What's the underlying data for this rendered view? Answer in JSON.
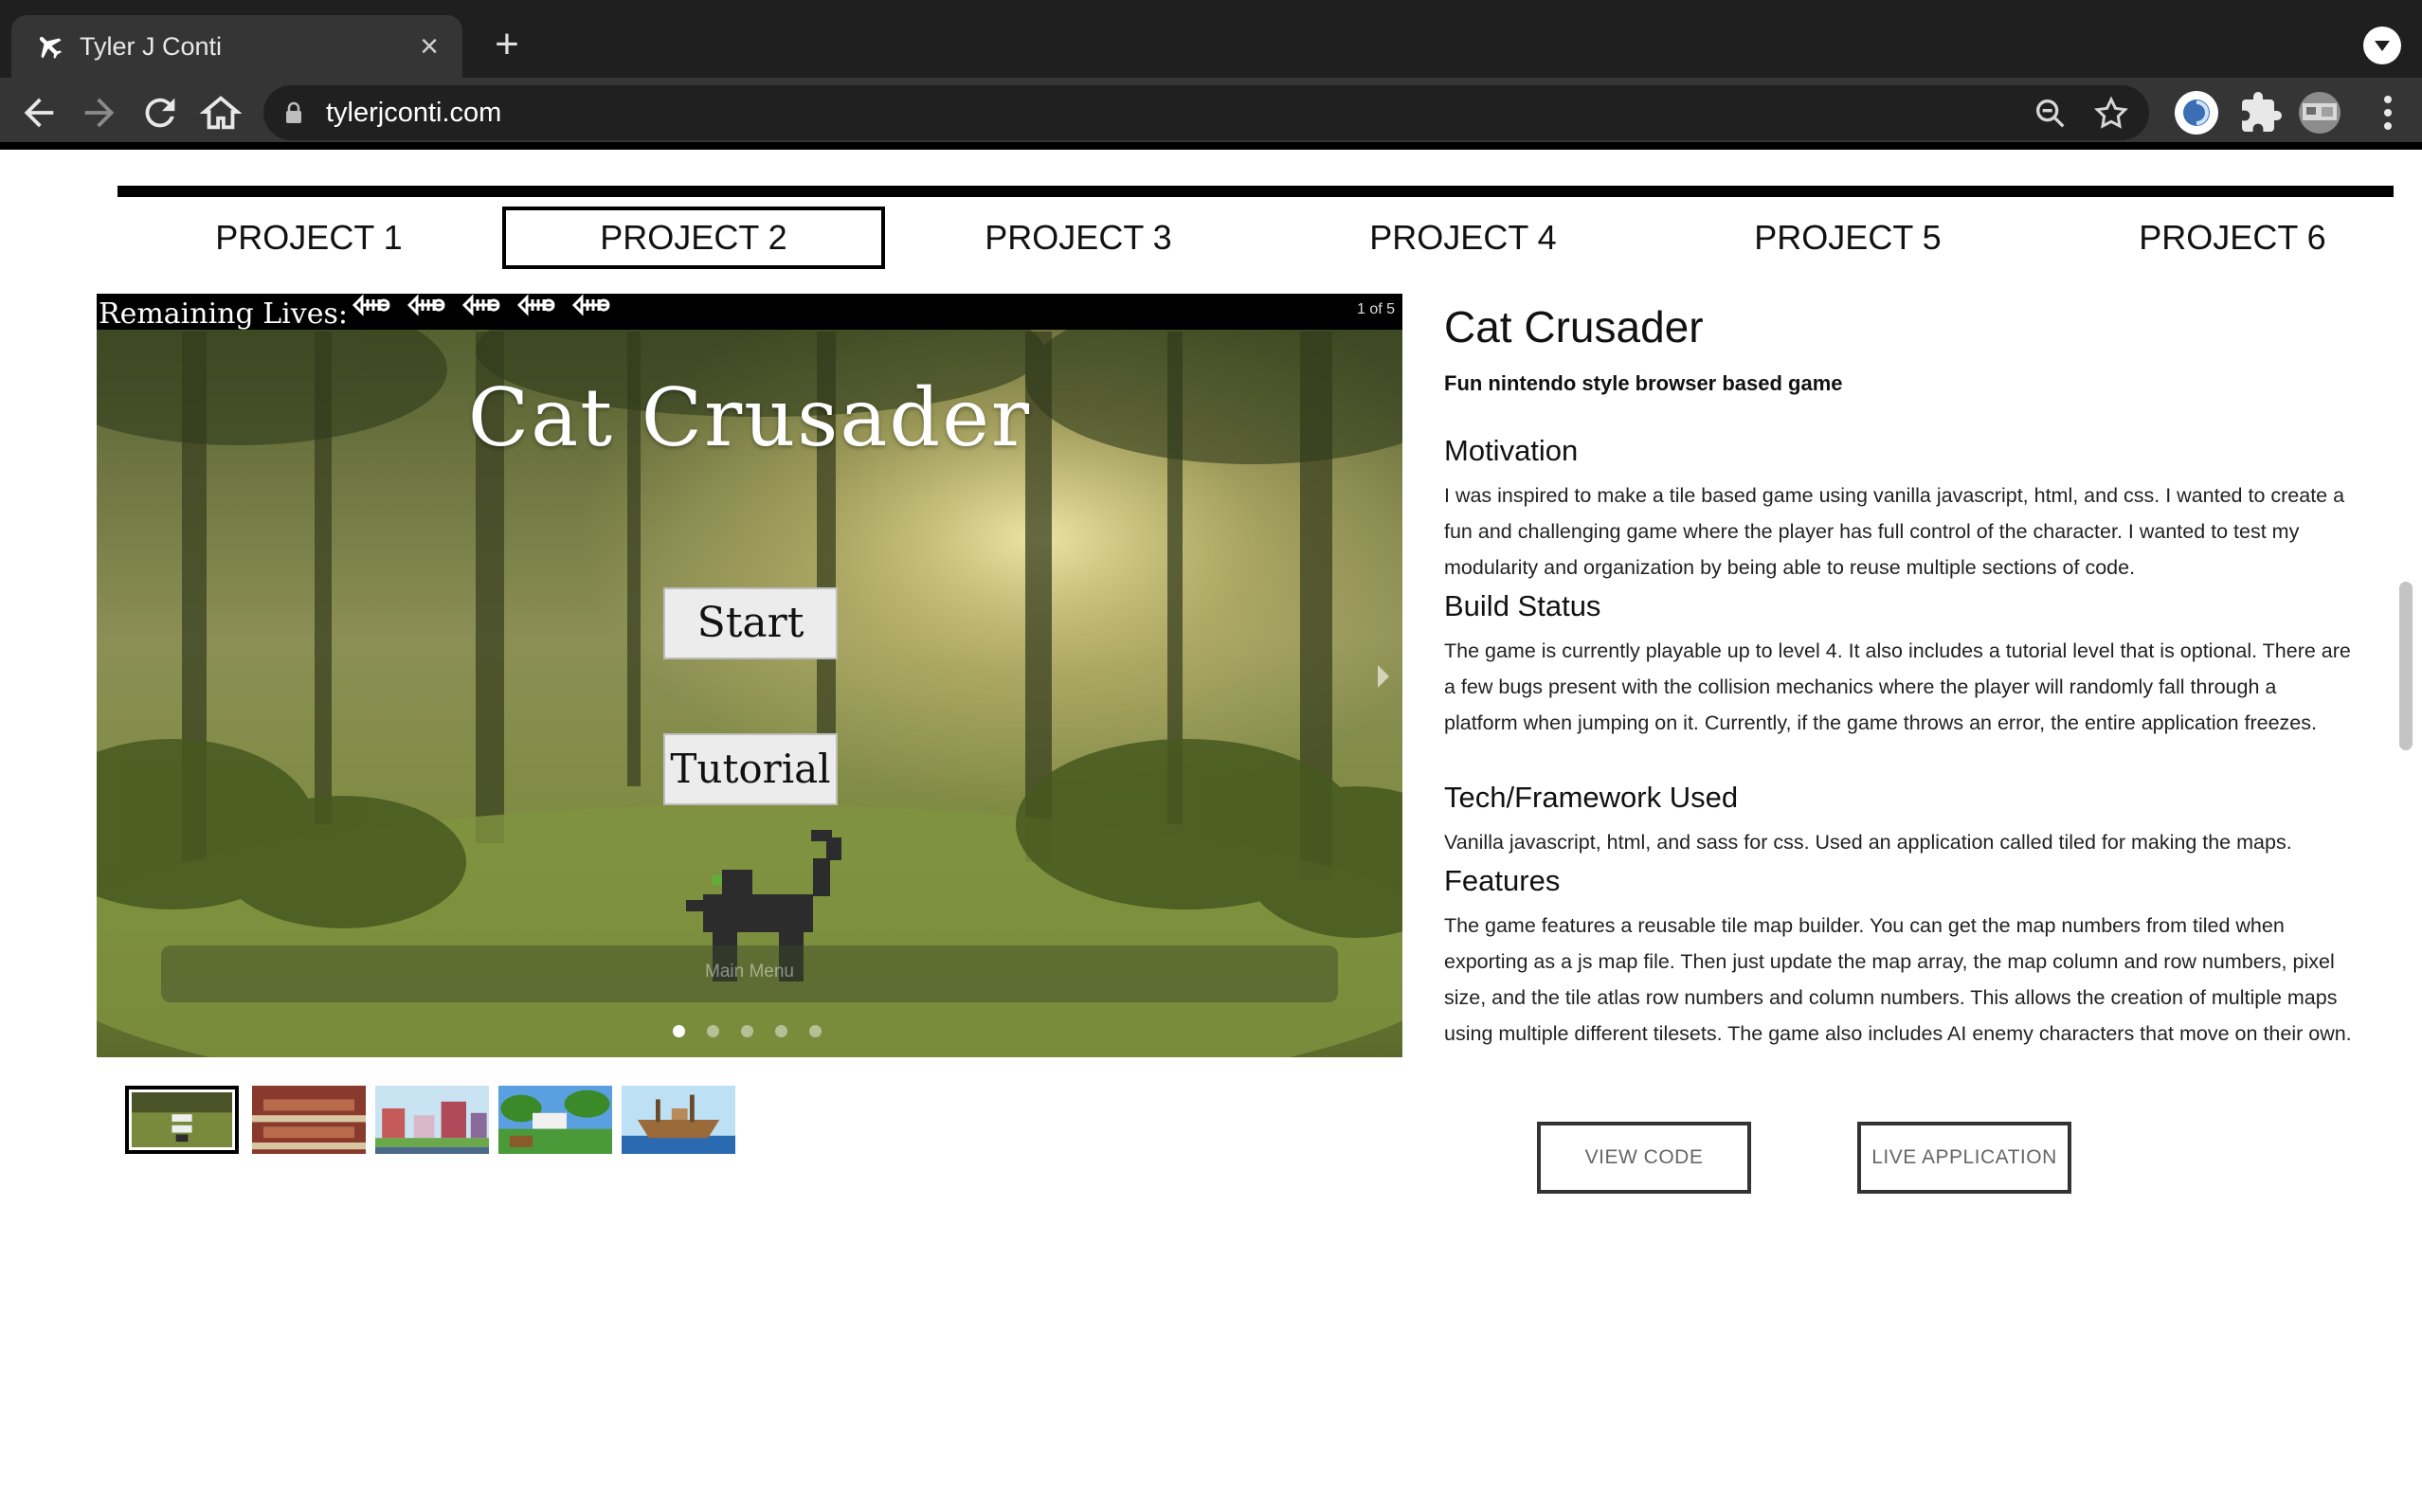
{
  "browser": {
    "tab_title": "Tyler J Conti",
    "url": "tylerjconti.com"
  },
  "project_tabs": [
    "PROJECT 1",
    "PROJECT 2",
    "PROJECT 3",
    "PROJECT 4",
    "PROJECT 5",
    "PROJECT 6"
  ],
  "active_project_index": 1,
  "carousel": {
    "lives_label": "Remaining Lives:",
    "lives_count": 5,
    "counter": "1 of 5",
    "game_title": "Cat Crusader",
    "start_label": "Start",
    "tutorial_label": "Tutorial",
    "main_menu_label": "Main Menu",
    "slide_count": 5,
    "active_slide": 0
  },
  "project": {
    "title": "Cat Crusader",
    "subtitle": "Fun nintendo style browser based game",
    "sections": [
      {
        "heading": "Motivation",
        "body": "I was inspired to make a tile based game using vanilla javascript, html, and css. I wanted to create a fun and challenging game where the player has full control of the character. I wanted to test my modularity and organization by being able to reuse multiple sections of code."
      },
      {
        "heading": "Build Status",
        "body": "The game is currently playable up to level 4. It also includes a tutorial level that is optional. There are a few bugs present with the collision mechanics where the player will randomly fall through a platform when jumping on it. Currently, if the game throws an error, the entire application freezes."
      },
      {
        "heading": "Tech/Framework Used",
        "body": "Vanilla javascript, html, and sass for css. Used an application called tiled for making the maps."
      },
      {
        "heading": "Features",
        "body": "The game features a reusable tile map builder. You can get the map numbers from tiled when exporting as a js map file. Then just update the map array, the map column and row numbers, pixel size, and the tile atlas row numbers and column numbers. This allows the creation of multiple maps using multiple different tilesets. The game also includes AI enemy characters that move on their own."
      }
    ],
    "view_code_label": "VIEW CODE",
    "live_app_label": "LIVE APPLICATION"
  }
}
